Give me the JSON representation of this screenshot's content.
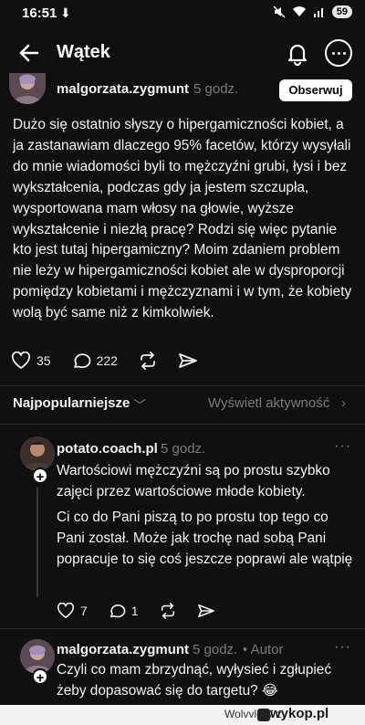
{
  "status": {
    "time": "16:51",
    "download_glyph": "⬇",
    "battery": "59"
  },
  "header": {
    "title": "Wątek"
  },
  "post": {
    "username": "malgorzata.zygmunt",
    "time": "5 godz.",
    "follow_label": "Obserwuj",
    "text": "Dużo się ostatnio słyszy o hipergamiczności kobiet, a ja zastanawiam dlaczego 95% facetów, którzy wysyłali do mnie wiadomości byli to mężczyźni grubi, łysi i bez wykształcenia, podczas gdy ja jestem szczupła, wysportowana mam włosy na głowie, wyższe wykształcenie i niezłą pracę? Rodzi się więc pytanie kto jest tutaj hipergamiczny? Moim zdaniem problem nie leży w hipergamiczności kobiet ale w dysproporcji pomiędzy  kobietami i mężczyznami i w tym, że kobiety wolą być same niż z kimkolwiek.",
    "likes": "35",
    "comments": "222"
  },
  "sort": {
    "label": "Najpopularniejsze",
    "activity": "Wyświetl aktywność"
  },
  "replies": [
    {
      "username": "potato.coach.pl",
      "time": "5 godz.",
      "paragraph1": "Wartościowi mężczyźni są po prostu szybko zajęci przez wartościowe młode kobiety.",
      "paragraph2": "Ci co do Pani piszą to po prostu top tego co Pani został. Może jak trochę nad sobą Pani popracuje to się coś jeszcze poprawi ale wątpię",
      "likes": "7",
      "comments": "1"
    },
    {
      "username": "malgorzata.zygmunt",
      "time": "5 godz.",
      "author_tag": "• Autor",
      "text": "Czyli co mam zbrzydnąć, wyłysieć i zgłupieć żeby dopasować się do targetu? 😂"
    }
  ],
  "footer": {
    "credit": "WolvvloW z",
    "brand": "wykop.pl"
  },
  "icons": [
    "back-arrow-icon",
    "bell-icon",
    "more-icon",
    "heart-icon",
    "comment-icon",
    "repost-icon",
    "share-icon",
    "chevron-down-icon",
    "chevron-right-icon",
    "plus-icon",
    "wifi-icon",
    "signal-icon",
    "mute-icon"
  ]
}
